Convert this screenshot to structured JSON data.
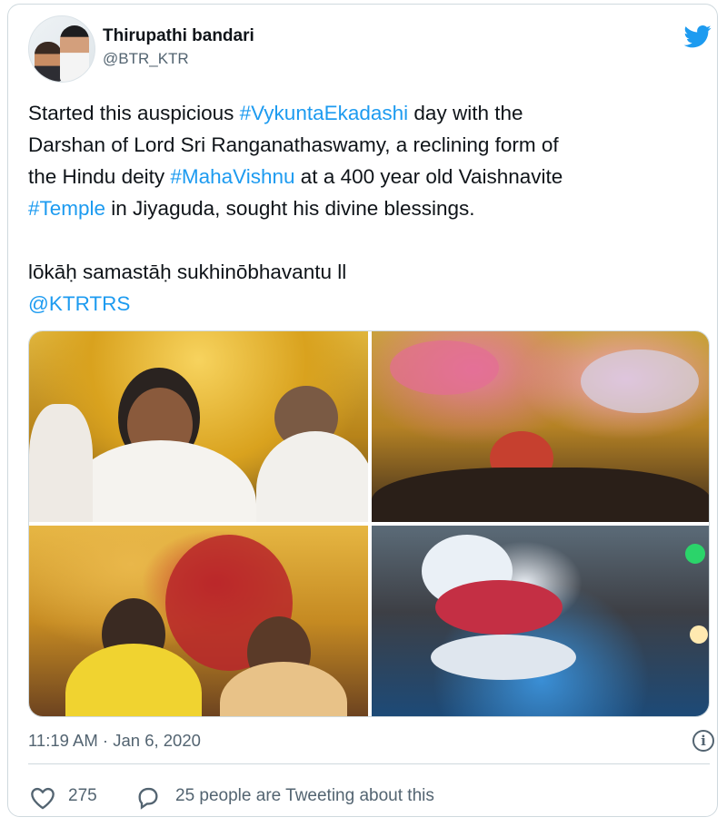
{
  "author": {
    "name": "Thirupathi bandari",
    "handle": "@BTR_KTR",
    "avatar_icon": "profile-photo",
    "brand_icon": "twitter-bird-icon",
    "brand_color": "#1d9bf0"
  },
  "tweet": {
    "line1": {
      "pre": "Started this auspicious ",
      "tag": "#VykuntaEkadashi",
      "post": " day with the"
    },
    "line2": "Darshan of Lord Sri Ranganathaswamy, a reclining form of",
    "line3": {
      "pre": "the Hindu deity ",
      "tag": "#MahaVishnu",
      "post": " at a 400 year old Vaishnavite"
    },
    "line4": {
      "tag": "#Temple",
      "post": " in Jiyaguda, sought his divine blessings."
    },
    "line5": "lōkāḥ samastāḥ sukhinōbhavantu ll",
    "mention": "@KTRTRS",
    "link_color": "#1d9bf0"
  },
  "media": {
    "count": 4
  },
  "meta": {
    "timestamp": "11:19 AM · Jan 6, 2020",
    "info_glyph": "i"
  },
  "actions": {
    "like_count": "275",
    "retweet_text": "25 people are Tweeting about this",
    "like_icon": "heart-icon",
    "reply_icon": "speech-bubble-icon"
  }
}
